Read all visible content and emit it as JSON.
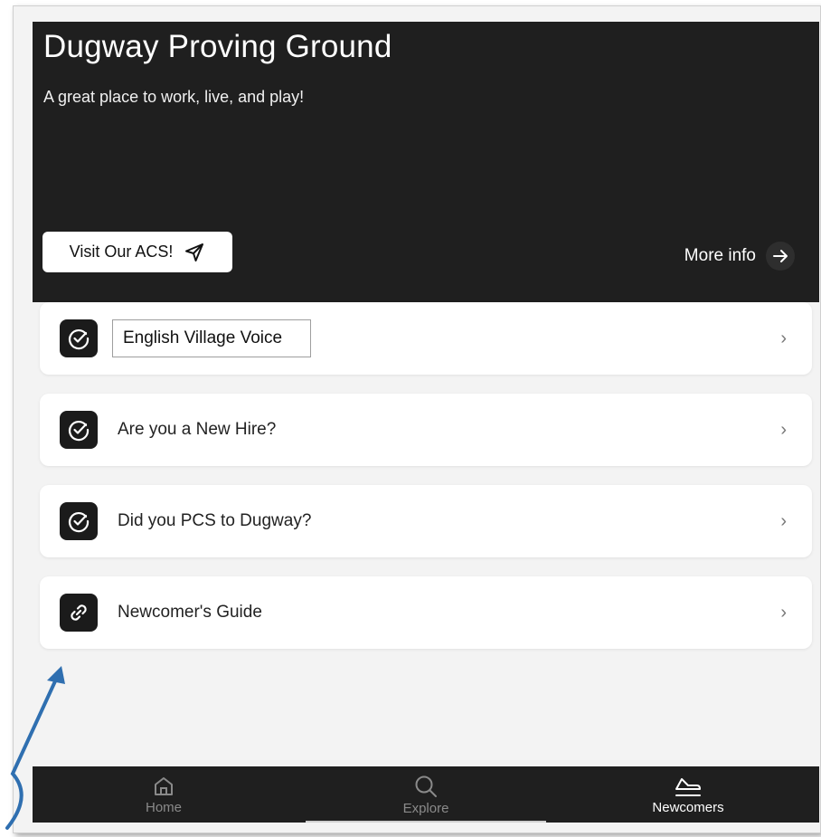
{
  "hero": {
    "title": "Dugway Proving Ground",
    "subtitle": "A great place to work, live, and play!",
    "acs_button": "Visit Our ACS!",
    "more_info": "More info"
  },
  "list": {
    "items": [
      {
        "label": "English Village Voice",
        "icon": "check-circle-icon"
      },
      {
        "label": "Are you a New Hire?",
        "icon": "check-circle-icon"
      },
      {
        "label": "Did you PCS to Dugway?",
        "icon": "check-circle-icon"
      },
      {
        "label": "Newcomer's Guide",
        "icon": "link-icon"
      }
    ]
  },
  "tabs": [
    {
      "label": "Home",
      "icon": "home-icon",
      "active": false
    },
    {
      "label": "Explore",
      "icon": "search-icon",
      "active": false
    },
    {
      "label": "Newcomers",
      "icon": "newcomers-icon",
      "active": true
    }
  ],
  "colors": {
    "hero_bg": "#1f1f1f",
    "page_bg": "#f3f3f3",
    "card_bg": "#ffffff",
    "annotation_arrow": "#2f6fb0"
  }
}
